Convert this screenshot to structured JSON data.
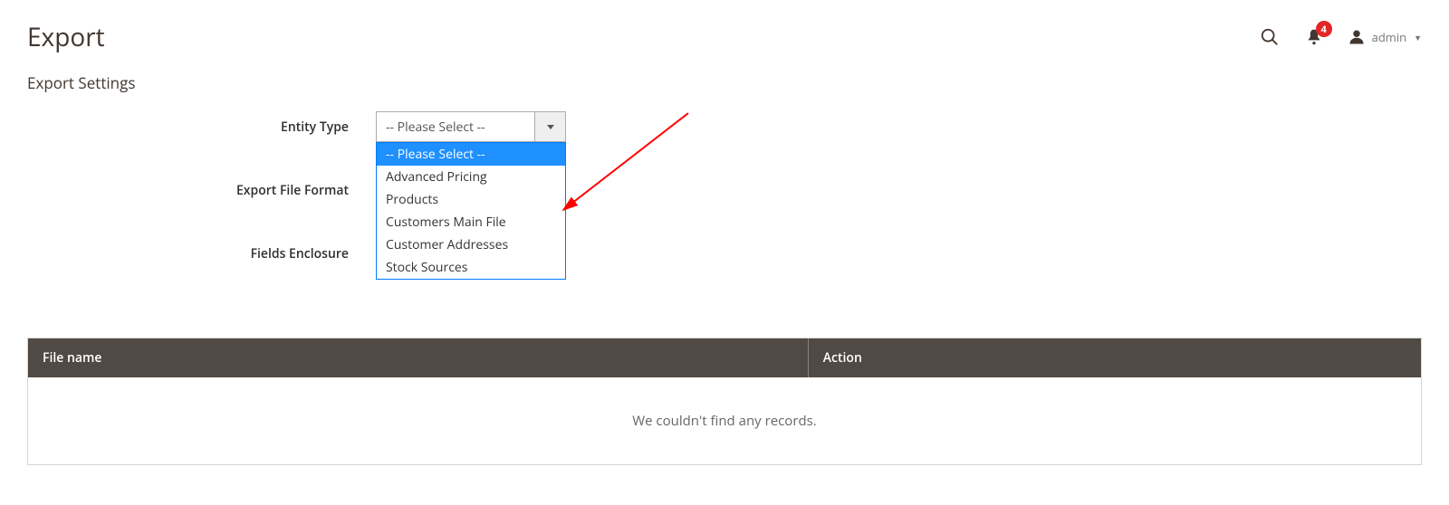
{
  "header": {
    "title": "Export",
    "notification_count": "4",
    "username": "admin"
  },
  "section": {
    "title": "Export Settings"
  },
  "form": {
    "entity_type_label": "Entity Type",
    "entity_type_value": "-- Please Select --",
    "entity_type_options": [
      "-- Please Select --",
      "Advanced Pricing",
      "Products",
      "Customers Main File",
      "Customer Addresses",
      "Stock Sources"
    ],
    "file_format_label": "Export File Format",
    "fields_enclosure_label": "Fields Enclosure"
  },
  "table": {
    "col_filename": "File name",
    "col_action": "Action",
    "empty_message": "We couldn't find any records."
  }
}
